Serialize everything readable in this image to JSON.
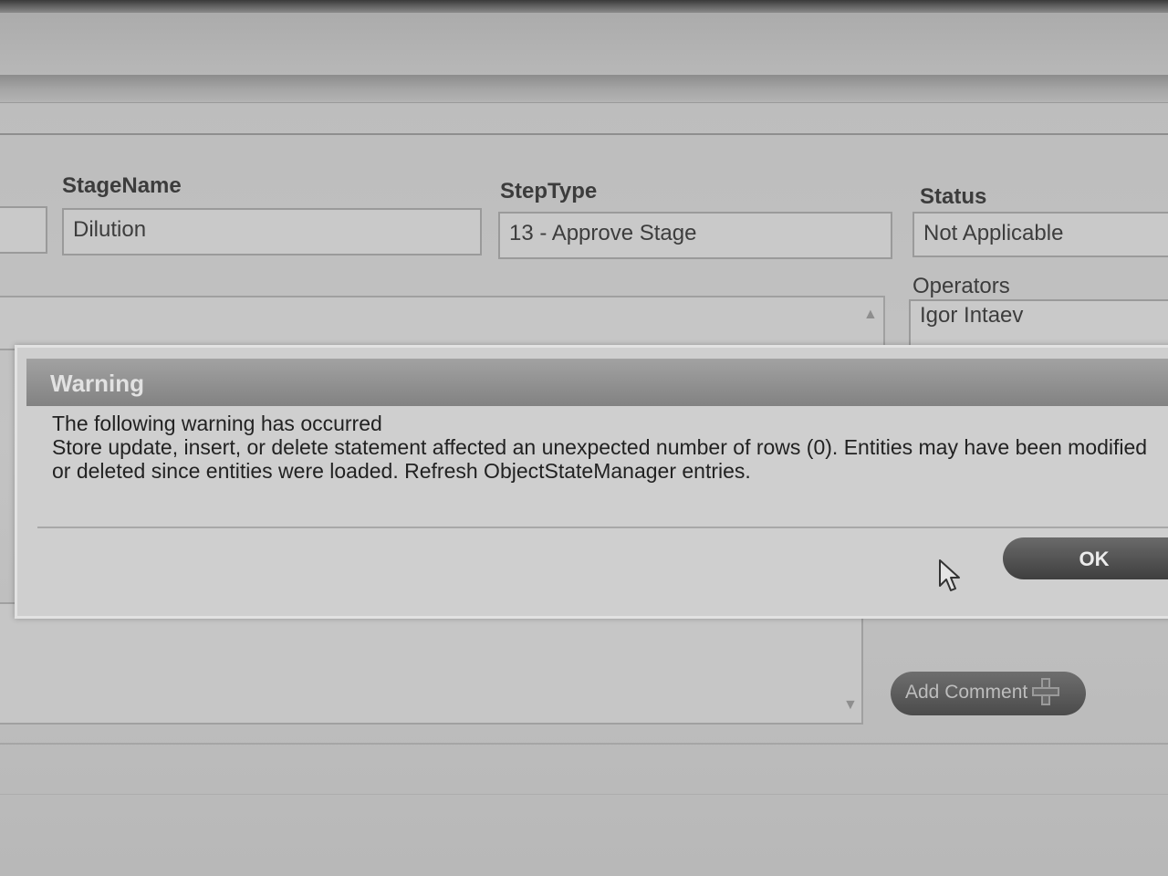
{
  "form": {
    "stage_name": {
      "label": "StageName",
      "value": "Dilution"
    },
    "step_type": {
      "label": "StepType",
      "value": "13 - Approve Stage"
    },
    "status": {
      "label": "Status",
      "value": "Not Applicable"
    },
    "operators": {
      "label": "Operators",
      "value": "Igor Intaev"
    }
  },
  "dialog": {
    "title": "Warning",
    "line1": "The following warning has occurred",
    "line2": "Store update, insert, or delete statement affected an unexpected number of rows (0). Entities may have been modified or deleted since entities were loaded. Refresh ObjectStateManager entries.",
    "ok_label": "OK"
  },
  "comments": {
    "add_label": "Add Comment",
    "add_icon": "plus-icon"
  }
}
